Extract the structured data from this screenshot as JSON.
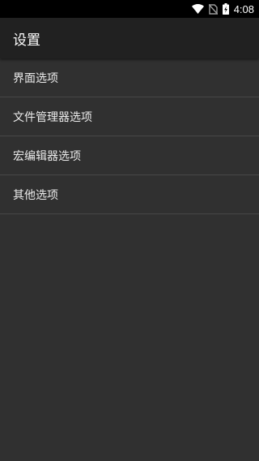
{
  "status_bar": {
    "time": "4:08",
    "icons": [
      "wifi-icon",
      "no-sim-icon",
      "battery-charging-icon"
    ]
  },
  "app_bar": {
    "title": "设置"
  },
  "settings_list": {
    "items": [
      {
        "label": "界面选项"
      },
      {
        "label": "文件管理器选项"
      },
      {
        "label": "宏编辑器选项"
      },
      {
        "label": "其他选项"
      }
    ]
  },
  "colors": {
    "status_bar": "#000000",
    "app_bar": "#212121",
    "background": "#303030",
    "divider": "#474747",
    "text": "#ececec"
  }
}
